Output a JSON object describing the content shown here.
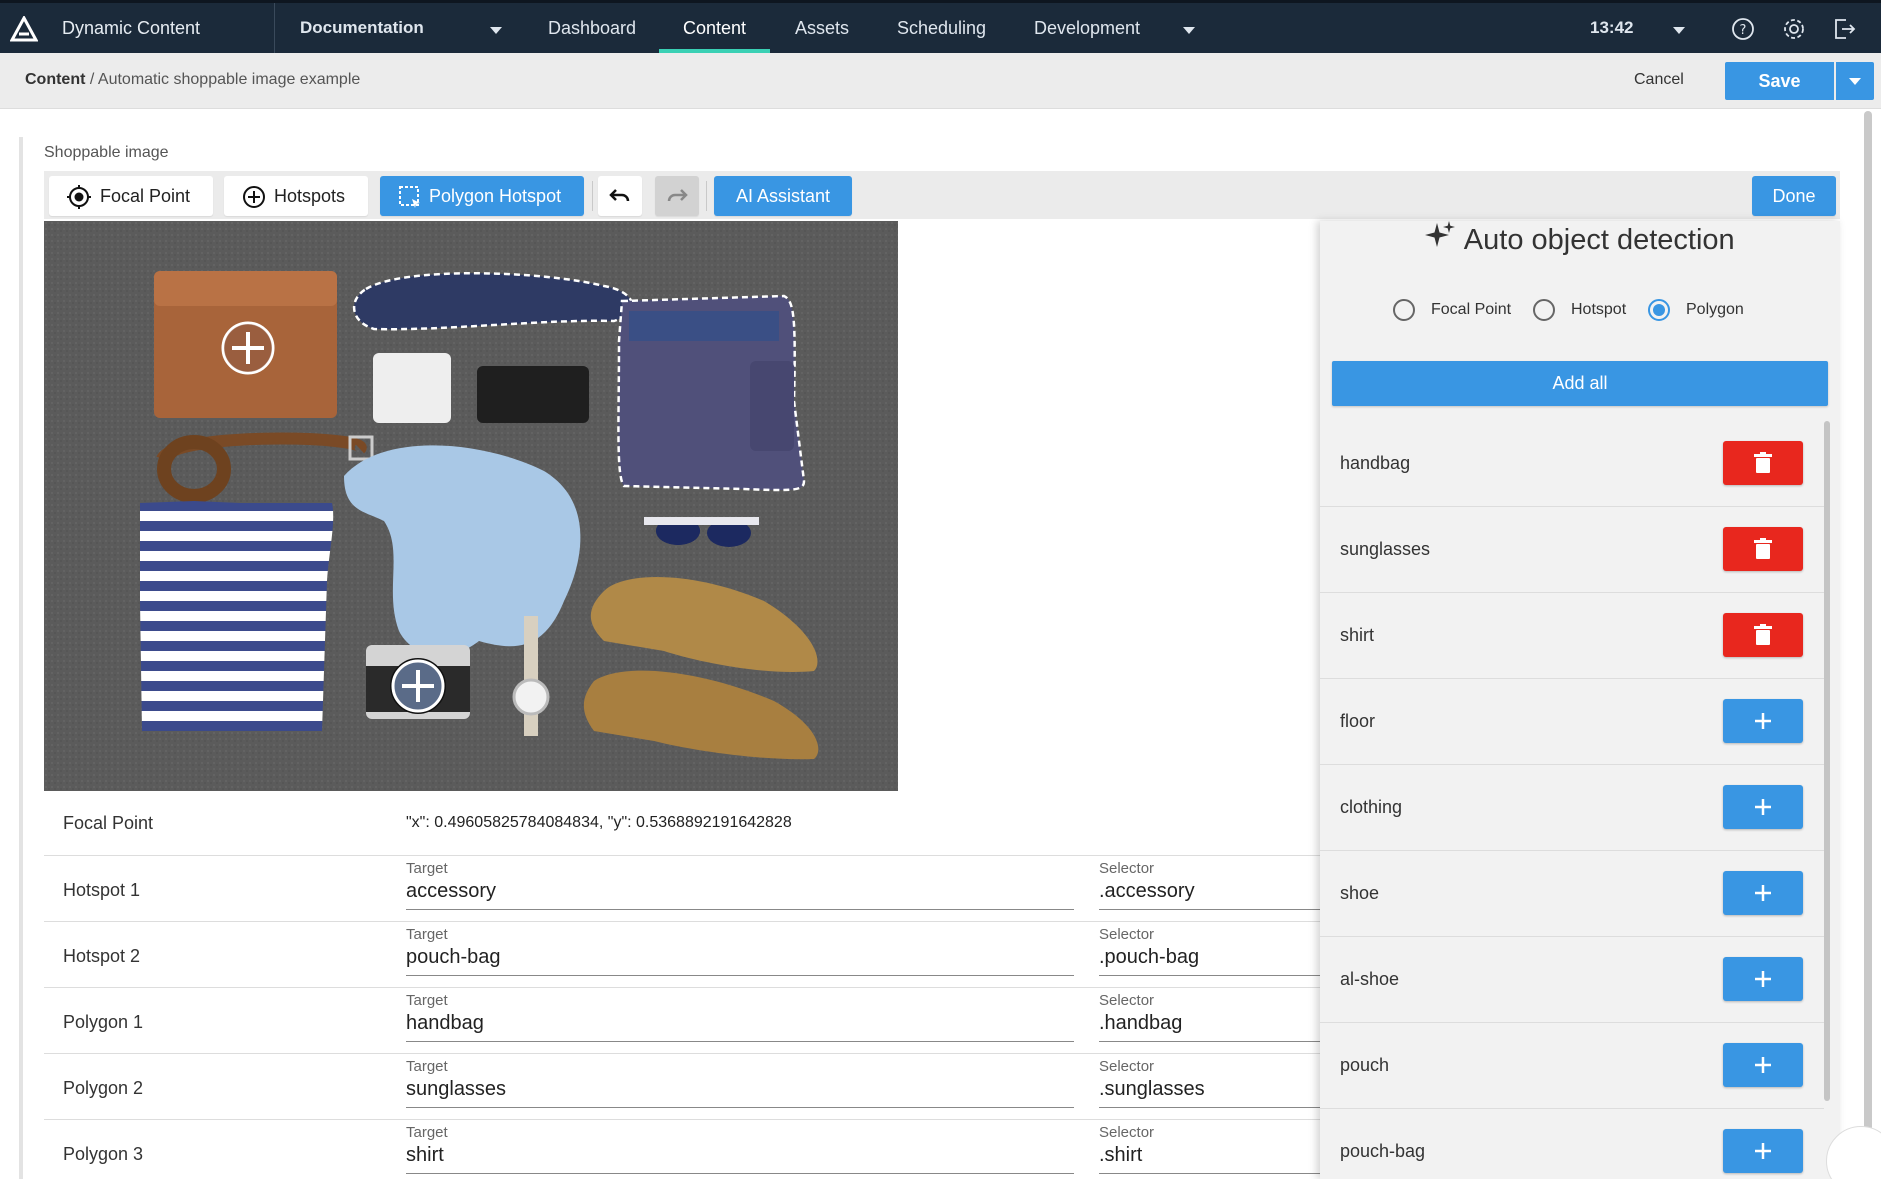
{
  "topbar": {
    "app_title": "Dynamic Content",
    "hub": "Documentation",
    "nav": [
      "Dashboard",
      "Content",
      "Assets",
      "Scheduling",
      "Development"
    ],
    "active_nav": "Content",
    "time": "13:42"
  },
  "breadcrumb": {
    "root": "Content",
    "separator": "/",
    "current": "Automatic shoppable image example"
  },
  "actions": {
    "cancel": "Cancel",
    "save": "Save"
  },
  "field_label": "Shoppable image",
  "toolbar": {
    "focal_point": "Focal Point",
    "hotspots": "Hotspots",
    "polygon_hotspot": "Polygon Hotspot",
    "ai_assistant": "AI Assistant",
    "done": "Done"
  },
  "rows": [
    {
      "label": "Focal Point",
      "value": "\"x\": 0.49605825784084834, \"y\": 0.5368892191642828"
    },
    {
      "label": "Hotspot 1",
      "target_label": "Target",
      "target": "accessory",
      "selector_label": "Selector",
      "selector": ".accessory"
    },
    {
      "label": "Hotspot 2",
      "target_label": "Target",
      "target": "pouch-bag",
      "selector_label": "Selector",
      "selector": ".pouch-bag"
    },
    {
      "label": "Polygon 1",
      "target_label": "Target",
      "target": "handbag",
      "selector_label": "Selector",
      "selector": ".handbag"
    },
    {
      "label": "Polygon 2",
      "target_label": "Target",
      "target": "sunglasses",
      "selector_label": "Selector",
      "selector": ".sunglasses"
    },
    {
      "label": "Polygon 3",
      "target_label": "Target",
      "target": "shirt",
      "selector_label": "Selector",
      "selector": ".shirt"
    }
  ],
  "panel": {
    "title": "Auto object detection",
    "modes": [
      "Focal Point",
      "Hotspot",
      "Polygon"
    ],
    "selected_mode": "Polygon",
    "add_all": "Add all",
    "objects": [
      {
        "name": "handbag",
        "state": "delete"
      },
      {
        "name": "sunglasses",
        "state": "delete"
      },
      {
        "name": "shirt",
        "state": "delete"
      },
      {
        "name": "floor",
        "state": "add"
      },
      {
        "name": "clothing",
        "state": "add"
      },
      {
        "name": "shoe",
        "state": "add"
      },
      {
        "name": "al-shoe",
        "state": "add"
      },
      {
        "name": "pouch",
        "state": "add"
      },
      {
        "name": "pouch-bag",
        "state": "add"
      }
    ]
  },
  "colors": {
    "topbar": "#1b2a3a",
    "accent": "#3996e3",
    "active_tab": "#3ad0b4",
    "delete": "#e8271e"
  }
}
